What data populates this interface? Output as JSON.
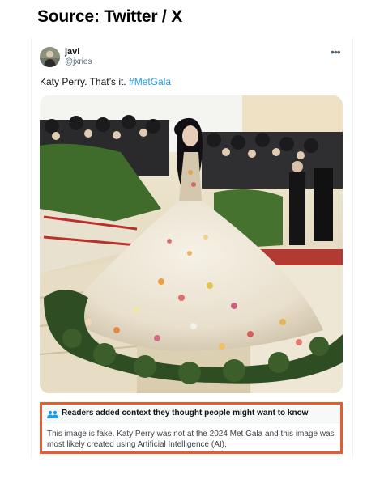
{
  "source_label": "Source: Twitter / X",
  "tweet": {
    "author_name": "javi",
    "author_handle": "@jxries",
    "text_plain": "Katy Perry. That’s it. ",
    "hashtag": "#MetGala",
    "more_icon": "more-horizontal-icon"
  },
  "community_note": {
    "icon": "people-icon",
    "title": "Readers added context they thought people might want to know",
    "body": "This image is fake. Katy Perry was not at the 2024 Met Gala and this image was most likely created using Artificial Intelligence (AI).",
    "border_color": "#e65c2e"
  },
  "colors": {
    "hashtag": "#1d9bf0",
    "secondary_text": "#536471"
  }
}
